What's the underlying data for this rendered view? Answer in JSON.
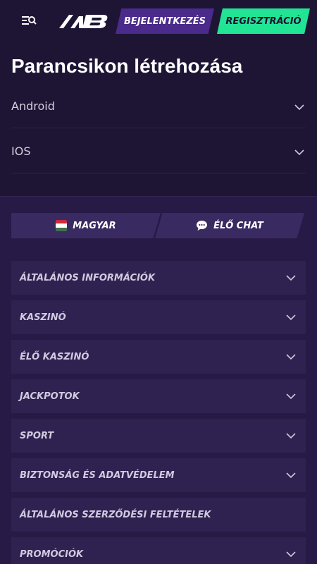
{
  "header": {
    "login_label": "BEJELENTKEZÉS",
    "register_label": "REGISZTRÁCIÓ",
    "icons": {
      "menu": "menu-search-icon",
      "logo": "nb-logo"
    },
    "colors": {
      "login": "#4a2a8a",
      "register": "#21e595"
    }
  },
  "shortcut": {
    "title": "Parancsikon létrehozása",
    "items": [
      {
        "label": "Android"
      },
      {
        "label": "IOS"
      }
    ]
  },
  "actions": {
    "language_label": "MAGYAR",
    "chat_label": "ÉLŐ CHAT",
    "icons": {
      "language": "hungary-flag-icon",
      "chat": "chat-bubble-icon"
    }
  },
  "sections": [
    {
      "label": "ÁLTALÁNOS INFORMÁCIÓK",
      "expandable": true
    },
    {
      "label": "KASZINÓ",
      "expandable": true
    },
    {
      "label": "ÉLŐ KASZINÓ",
      "expandable": true
    },
    {
      "label": "JACKPOTOK",
      "expandable": true
    },
    {
      "label": "SPORT",
      "expandable": true
    },
    {
      "label": "BIZTONSÁG ÉS ADATVÉDELEM",
      "expandable": true
    },
    {
      "label": "ÁLTALÁNOS SZERZŐDÉSI FELTÉTELEK",
      "expandable": false
    },
    {
      "label": "PROMÓCIÓK",
      "expandable": true
    }
  ]
}
